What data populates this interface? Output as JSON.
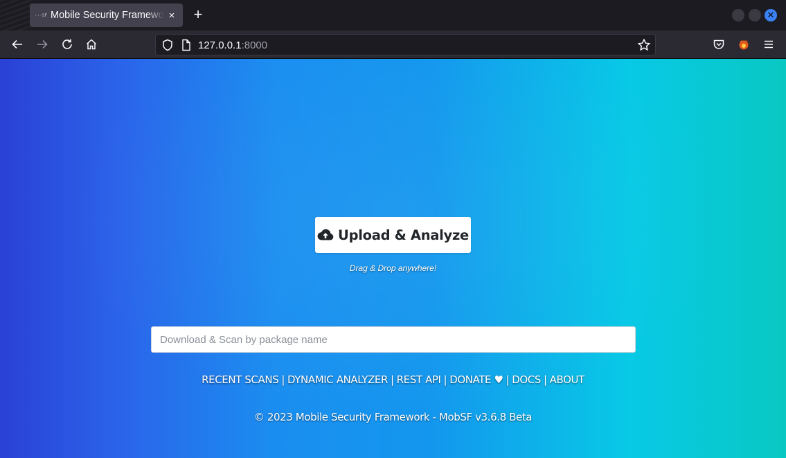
{
  "browser": {
    "tab": {
      "favicon_text": "···SF",
      "title": "Mobile Security Framework",
      "close": "×"
    },
    "new_tab": "+",
    "url": {
      "host": "127.0.0.1",
      "port": ":8000"
    }
  },
  "page": {
    "upload_label": "Upload & Analyze",
    "drag_hint": "Drag & Drop anywhere!",
    "package_input_placeholder": "Download & Scan by package name",
    "package_input_value": "",
    "links": [
      {
        "label": "RECENT SCANS"
      },
      {
        "label": "DYNAMIC ANALYZER"
      },
      {
        "label": "REST API"
      },
      {
        "label": "DONATE ♥"
      },
      {
        "label": "DOCS"
      },
      {
        "label": "ABOUT"
      }
    ],
    "link_separator": "|",
    "footer": "© 2023 Mobile Security Framework - MobSF v3.6.8 Beta"
  },
  "colors": {
    "gradient_left": "#2a41d6",
    "gradient_mid": "#1397ee",
    "gradient_right": "#09c8c3",
    "browser_chrome": "#1c1b22",
    "close_button": "#3b82f6"
  }
}
